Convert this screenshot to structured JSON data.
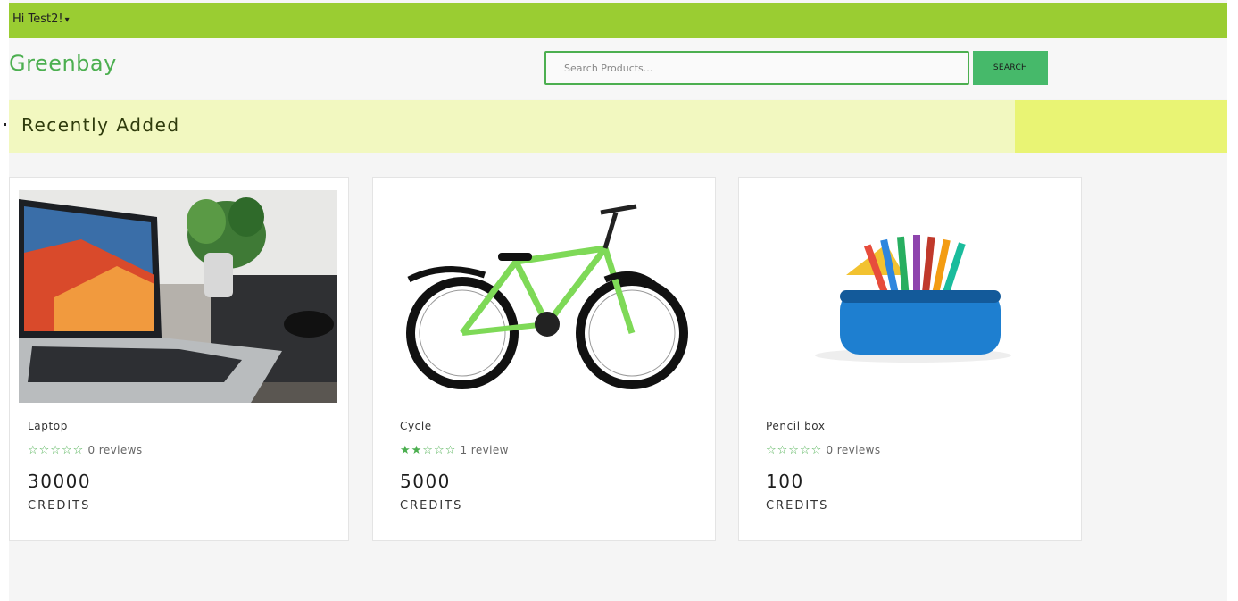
{
  "topbar": {
    "user_label": "Hi Test2!",
    "caret": "▾"
  },
  "header": {
    "logo": "Greenbay",
    "search_placeholder": "Search Products...",
    "search_button": "SEARCH"
  },
  "section": {
    "title": "Recently Added"
  },
  "products": [
    {
      "name": "Laptop",
      "stars": "☆☆☆☆☆",
      "reviews": "0 reviews",
      "price": "30000",
      "unit": "CREDITS"
    },
    {
      "name": "Cycle",
      "stars": "★★☆☆☆",
      "reviews": "1 review",
      "price": "5000",
      "unit": "CREDITS"
    },
    {
      "name": "Pencil box",
      "stars": "☆☆☆☆☆",
      "reviews": "0 reviews",
      "price": "100",
      "unit": "CREDITS"
    }
  ],
  "colors": {
    "topbar": "#9acd32",
    "brand": "#4caf50",
    "section_bg": "#f2f8c0",
    "section_accent": "#e9f474"
  }
}
